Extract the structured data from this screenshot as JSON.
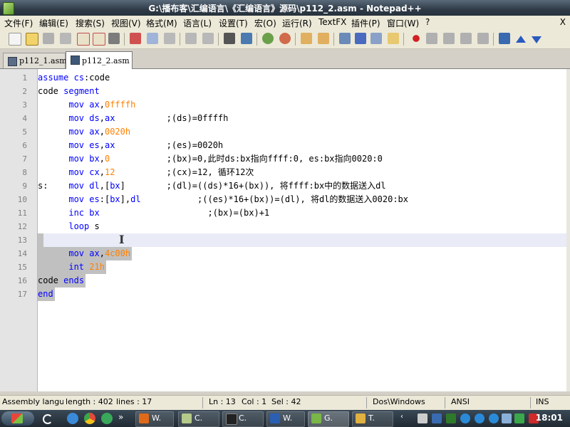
{
  "window": {
    "title": "G:\\播布客\\汇编语言\\《汇编语言》源码\\p112_2.asm - Notepad++",
    "close_glyph": "X"
  },
  "menu": {
    "items": [
      "文件(F)",
      "编辑(E)",
      "搜索(S)",
      "视图(V)",
      "格式(M)",
      "语言(L)",
      "设置(T)",
      "宏(O)",
      "运行(R)",
      "TextFX",
      "插件(P)",
      "窗口(W)",
      "?"
    ],
    "close_glyph": "X"
  },
  "toolbar": {
    "buttons": [
      "new-file",
      "open-file",
      "save",
      "save-all",
      "close",
      "close-all",
      "print",
      "cut",
      "copy",
      "paste",
      "undo",
      "redo",
      "find",
      "replace",
      "zoom-in",
      "zoom-out",
      "sync-vertical",
      "sync-horizontal",
      "word-wrap",
      "show-all-chars",
      "indent-guide",
      "user-lang",
      "doc-map",
      "record-macro",
      "stop-record",
      "play-macro",
      "play-multiple",
      "save-macro",
      "trim",
      "scroll-up",
      "scroll-down"
    ]
  },
  "tabs": [
    {
      "label": "p112_1.asm",
      "active": false
    },
    {
      "label": "p112_2.asm",
      "active": true
    }
  ],
  "editor": {
    "caret_line": 13,
    "lines": [
      {
        "n": "1",
        "tokens": [
          {
            "t": "assume",
            "c": "kw"
          },
          {
            "t": " ",
            "c": "plain"
          },
          {
            "t": "cs",
            "c": "kw"
          },
          {
            "t": ":code",
            "c": "plain"
          }
        ]
      },
      {
        "n": "2",
        "tokens": [
          {
            "t": "code",
            "c": "plain"
          },
          {
            "t": " ",
            "c": "plain"
          },
          {
            "t": "segment",
            "c": "kw"
          }
        ]
      },
      {
        "n": "3",
        "tokens": [
          {
            "t": "      ",
            "c": "plain"
          },
          {
            "t": "mov",
            "c": "ins"
          },
          {
            "t": " ",
            "c": "plain"
          },
          {
            "t": "ax",
            "c": "kw"
          },
          {
            "t": ",",
            "c": "plain"
          },
          {
            "t": "0ffffh",
            "c": "num"
          }
        ]
      },
      {
        "n": "4",
        "tokens": [
          {
            "t": "      ",
            "c": "plain"
          },
          {
            "t": "mov",
            "c": "ins"
          },
          {
            "t": " ",
            "c": "plain"
          },
          {
            "t": "ds",
            "c": "kw"
          },
          {
            "t": ",",
            "c": "plain"
          },
          {
            "t": "ax",
            "c": "kw"
          },
          {
            "t": "          ",
            "c": "plain"
          },
          {
            "t": ";(ds)=0ffffh",
            "c": "cmt"
          }
        ]
      },
      {
        "n": "5",
        "tokens": [
          {
            "t": "      ",
            "c": "plain"
          },
          {
            "t": "mov",
            "c": "ins"
          },
          {
            "t": " ",
            "c": "plain"
          },
          {
            "t": "ax",
            "c": "kw"
          },
          {
            "t": ",",
            "c": "plain"
          },
          {
            "t": "0020h",
            "c": "num"
          }
        ]
      },
      {
        "n": "6",
        "tokens": [
          {
            "t": "      ",
            "c": "plain"
          },
          {
            "t": "mov",
            "c": "ins"
          },
          {
            "t": " ",
            "c": "plain"
          },
          {
            "t": "es",
            "c": "kw"
          },
          {
            "t": ",",
            "c": "plain"
          },
          {
            "t": "ax",
            "c": "kw"
          },
          {
            "t": "          ",
            "c": "plain"
          },
          {
            "t": ";(es)=0020h",
            "c": "cmt"
          }
        ]
      },
      {
        "n": "7",
        "tokens": [
          {
            "t": "      ",
            "c": "plain"
          },
          {
            "t": "mov",
            "c": "ins"
          },
          {
            "t": " ",
            "c": "plain"
          },
          {
            "t": "bx",
            "c": "kw"
          },
          {
            "t": ",",
            "c": "plain"
          },
          {
            "t": "0",
            "c": "num"
          },
          {
            "t": "           ",
            "c": "plain"
          },
          {
            "t": ";(bx)=0,此时ds:bx指向ffff:0, es:bx指向0020:0",
            "c": "cmt"
          }
        ]
      },
      {
        "n": "8",
        "tokens": [
          {
            "t": "      ",
            "c": "plain"
          },
          {
            "t": "mov",
            "c": "ins"
          },
          {
            "t": " ",
            "c": "plain"
          },
          {
            "t": "cx",
            "c": "kw"
          },
          {
            "t": ",",
            "c": "plain"
          },
          {
            "t": "12",
            "c": "num"
          },
          {
            "t": "          ",
            "c": "plain"
          },
          {
            "t": ";(cx)=12, 循环12次",
            "c": "cmt"
          }
        ]
      },
      {
        "n": "9",
        "tokens": [
          {
            "t": "s:",
            "c": "lbl"
          },
          {
            "t": "    ",
            "c": "plain"
          },
          {
            "t": "mov",
            "c": "ins"
          },
          {
            "t": " ",
            "c": "plain"
          },
          {
            "t": "dl",
            "c": "kw"
          },
          {
            "t": ",[",
            "c": "plain"
          },
          {
            "t": "bx",
            "c": "kw"
          },
          {
            "t": "]",
            "c": "plain"
          },
          {
            "t": "        ",
            "c": "plain"
          },
          {
            "t": ";(dl)=((ds)*16+(bx)), 将ffff:bx中的数据送入dl",
            "c": "cmt"
          }
        ]
      },
      {
        "n": "10",
        "tokens": [
          {
            "t": "      ",
            "c": "plain"
          },
          {
            "t": "mov",
            "c": "ins"
          },
          {
            "t": " ",
            "c": "plain"
          },
          {
            "t": "es",
            "c": "kw"
          },
          {
            "t": ":[",
            "c": "plain"
          },
          {
            "t": "bx",
            "c": "kw"
          },
          {
            "t": "],",
            "c": "plain"
          },
          {
            "t": "dl",
            "c": "kw"
          },
          {
            "t": "           ",
            "c": "plain"
          },
          {
            "t": ";((es)*16+(bx))=(dl), 将dl的数据送入0020:bx",
            "c": "cmt"
          }
        ]
      },
      {
        "n": "11",
        "tokens": [
          {
            "t": "      ",
            "c": "plain"
          },
          {
            "t": "inc",
            "c": "ins"
          },
          {
            "t": " ",
            "c": "plain"
          },
          {
            "t": "bx",
            "c": "kw"
          },
          {
            "t": "                     ",
            "c": "plain"
          },
          {
            "t": ";(bx)=(bx)+1",
            "c": "cmt"
          }
        ]
      },
      {
        "n": "12",
        "tokens": [
          {
            "t": "      ",
            "c": "plain"
          },
          {
            "t": "loop",
            "c": "ins"
          },
          {
            "t": " s",
            "c": "plain"
          }
        ]
      },
      {
        "n": "13",
        "tokens": []
      },
      {
        "n": "14",
        "tokens": [
          {
            "t": "      ",
            "c": "plain"
          },
          {
            "t": "mov",
            "c": "ins"
          },
          {
            "t": " ",
            "c": "plain"
          },
          {
            "t": "ax",
            "c": "kw"
          },
          {
            "t": ",",
            "c": "plain"
          },
          {
            "t": "4c00h",
            "c": "num"
          }
        ]
      },
      {
        "n": "15",
        "tokens": [
          {
            "t": "      ",
            "c": "plain"
          },
          {
            "t": "int",
            "c": "ins"
          },
          {
            "t": " ",
            "c": "plain"
          },
          {
            "t": "21h",
            "c": "num"
          }
        ]
      },
      {
        "n": "16",
        "tokens": [
          {
            "t": "code",
            "c": "plain"
          },
          {
            "t": " ",
            "c": "plain"
          },
          {
            "t": "ends",
            "c": "kw"
          }
        ]
      },
      {
        "n": "17",
        "tokens": [
          {
            "t": "end",
            "c": "kw"
          }
        ]
      }
    ]
  },
  "statusbar": {
    "language": "Assembly language",
    "length": "length : 402",
    "lines": "lines : 17",
    "ln": "Ln : 13",
    "col": "Col : 1",
    "sel": "Sel : 42",
    "eol": "Dos\\Windows",
    "encoding": "ANSI",
    "mode": "INS"
  },
  "taskbar": {
    "buttons": [
      {
        "label": "W.",
        "icon": "wps-writer-icon",
        "color": "#e06a1a"
      },
      {
        "label": "C.",
        "icon": "notepad-icon",
        "color": "#b5c98a"
      },
      {
        "label": "C.",
        "icon": "cmd-icon",
        "color": "#222222"
      },
      {
        "label": "W.",
        "icon": "word-icon",
        "color": "#2b5fb3"
      },
      {
        "label": "G.",
        "icon": "notepadpp-icon",
        "color": "#7ab648"
      },
      {
        "label": "T.",
        "icon": "folder-icon",
        "color": "#e0b040"
      }
    ],
    "clock": "18:01"
  }
}
